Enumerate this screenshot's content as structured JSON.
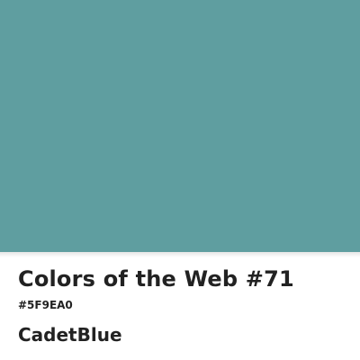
{
  "swatch": {
    "color": "#5F9EA0"
  },
  "info": {
    "title": "Colors of the Web #71",
    "hex": "#5F9EA0",
    "name": "CadetBlue"
  }
}
